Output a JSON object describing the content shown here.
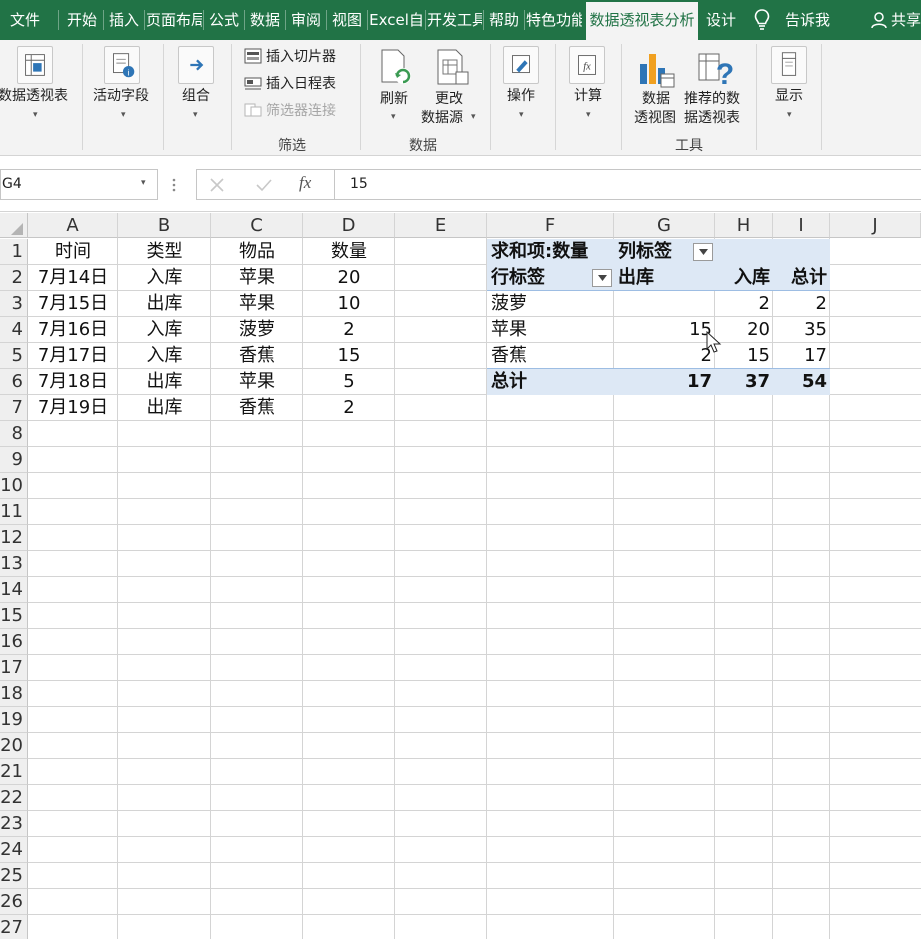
{
  "ribbon_tabs": [
    "文件",
    "开始",
    "插入",
    "页面布局",
    "公式",
    "数据",
    "审阅",
    "视图",
    "Excel自",
    "开发工具",
    "帮助",
    "特色功能",
    "数据透视表分析",
    "设计",
    "告诉我",
    "共享"
  ],
  "active_tab": "数据透视表分析",
  "ribbon": {
    "pivot_table": "数据透视表",
    "active_field": "活动字段",
    "group": "组合",
    "insert_slicer": "插入切片器",
    "insert_timeline": "插入日程表",
    "filter_connections": "筛选器连接",
    "filter_group": "筛选",
    "refresh": "刷新",
    "change_source_1": "更改",
    "change_source_2": "数据源",
    "data_group": "数据",
    "actions": "操作",
    "calculations": "计算",
    "pivot_chart_1": "数据",
    "pivot_chart_2": "透视图",
    "recommended_1": "推荐的数",
    "recommended_2": "据透视表",
    "tools_group": "工具",
    "show": "显示"
  },
  "formula_bar": {
    "name_box": "G4",
    "value": "15",
    "fx": "fx"
  },
  "columns": [
    "A",
    "B",
    "C",
    "D",
    "E",
    "F",
    "G",
    "H",
    "I",
    "J"
  ],
  "rows": [
    "1",
    "2",
    "3",
    "4",
    "5",
    "6",
    "7",
    "8",
    "9",
    "10",
    "11",
    "12",
    "13",
    "14",
    "15",
    "16",
    "17",
    "18",
    "19",
    "20",
    "21",
    "22",
    "23",
    "24",
    "25",
    "26",
    "27"
  ],
  "source_table": {
    "headers": [
      "时间",
      "类型",
      "物品",
      "数量"
    ],
    "rows": [
      [
        "7月14日",
        "入库",
        "苹果",
        "20"
      ],
      [
        "7月15日",
        "出库",
        "苹果",
        "10"
      ],
      [
        "7月16日",
        "入库",
        "菠萝",
        "2"
      ],
      [
        "7月17日",
        "入库",
        "香蕉",
        "15"
      ],
      [
        "7月18日",
        "出库",
        "苹果",
        "5"
      ],
      [
        "7月19日",
        "出库",
        "香蕉",
        "2"
      ]
    ]
  },
  "pivot": {
    "value_field": "求和项:数量",
    "column_labels": "列标签",
    "row_labels": "行标签",
    "col_headers": [
      "出库",
      "入库",
      "总计"
    ],
    "rows": [
      {
        "label": "菠萝",
        "values": [
          "",
          "2",
          "2"
        ]
      },
      {
        "label": "苹果",
        "values": [
          "15",
          "20",
          "35"
        ]
      },
      {
        "label": "香蕉",
        "values": [
          "2",
          "15",
          "17"
        ]
      }
    ],
    "total": {
      "label": "总计",
      "values": [
        "17",
        "37",
        "54"
      ]
    }
  },
  "colors": {
    "ribbon_green": "#217346",
    "pivot_header_fill": "#dde8f5",
    "gridline": "#d4d4d4"
  }
}
